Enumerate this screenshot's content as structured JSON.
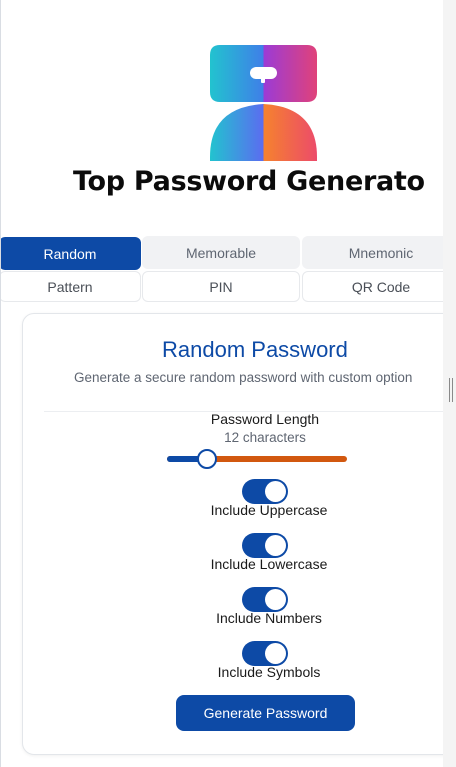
{
  "app": {
    "title": "Top Password Generato"
  },
  "tabs": {
    "row1": [
      "Random",
      "Memorable",
      "Mnemonic"
    ],
    "row2": [
      "Pattern",
      "PIN",
      "QR Code"
    ],
    "active": "Random"
  },
  "card": {
    "title": "Random Password",
    "subtitle": "Generate a secure random password with custom option",
    "length_label": "Password Length",
    "length_value": "12 characters",
    "length_fraction": 0.22,
    "options": [
      {
        "label": "Include Uppercase",
        "on": true
      },
      {
        "label": "Include Lowercase",
        "on": true
      },
      {
        "label": "Include Numbers",
        "on": true
      },
      {
        "label": "Include Symbols",
        "on": true
      }
    ],
    "button_label": "Generate Password"
  },
  "colors": {
    "primary": "#0d4aa6",
    "accent": "#d2580f"
  }
}
